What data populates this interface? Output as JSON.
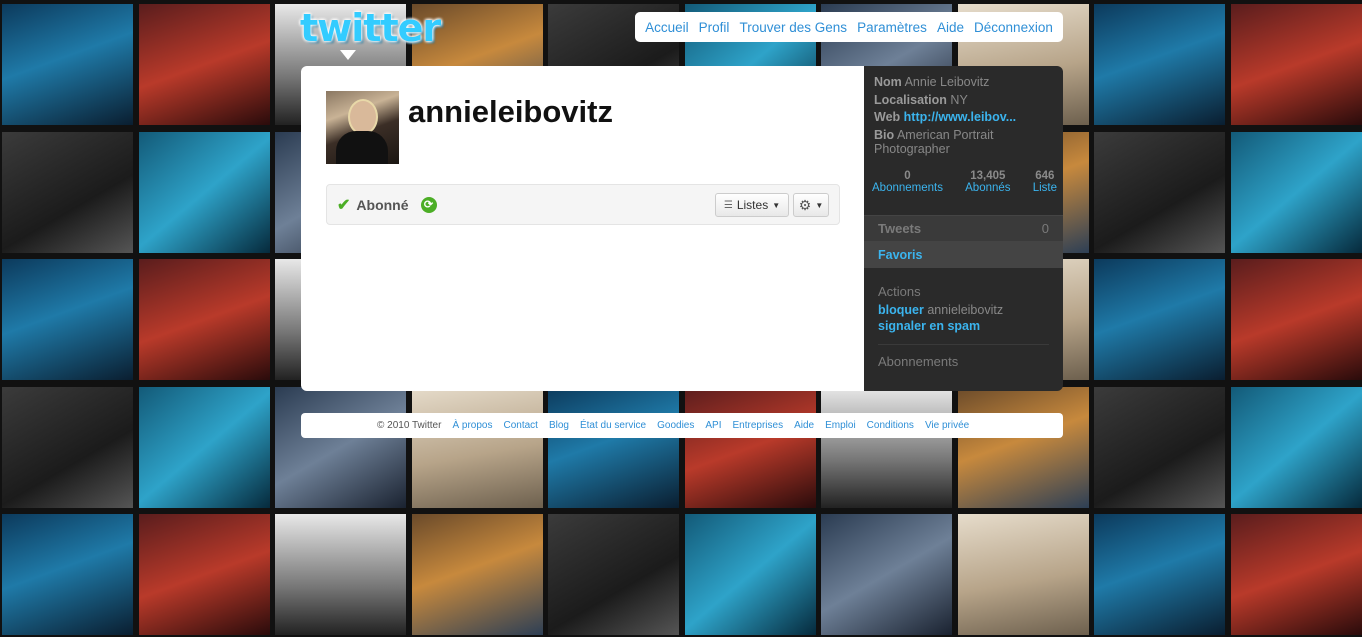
{
  "logo": {
    "text": "twitter"
  },
  "nav": {
    "items": [
      "Accueil",
      "Profil",
      "Trouver des Gens",
      "Paramètres",
      "Aide",
      "Déconnexion"
    ]
  },
  "profile": {
    "screen_name": "annieleibovitz"
  },
  "follow": {
    "state": "Abonné",
    "lists_label": "Listes",
    "check_icon": "checkmark-icon",
    "refresh_icon": "refresh-icon"
  },
  "sidebar": {
    "name_label": "Nom",
    "name_value": "Annie Leibovitz",
    "location_label": "Localisation",
    "location_value": "NY",
    "web_label": "Web",
    "web_value": "http://www.leibov...",
    "bio_label": "Bio",
    "bio_value": "American Portrait Photographer",
    "stats": [
      {
        "count": "0",
        "label": "Abonnements"
      },
      {
        "count": "13,405",
        "label": "Abonnés"
      },
      {
        "count": "646",
        "label": "Liste"
      }
    ],
    "tweets_label": "Tweets",
    "tweets_count": "0",
    "favorites_label": "Favoris",
    "actions_heading": "Actions",
    "block_link": "bloquer",
    "block_user": "annieleibovitz",
    "report_link": "signaler en spam",
    "following_heading": "Abonnements"
  },
  "footer": {
    "copyright": "© 2010 Twitter",
    "links": [
      "À propos",
      "Contact",
      "Blog",
      "État du service",
      "Goodies",
      "API",
      "Entreprises",
      "Aide",
      "Emploi",
      "Conditions",
      "Vie privée"
    ]
  },
  "colors": {
    "accent": "#2f8fd6",
    "sidebar_bg": "#2a2a2a",
    "sidebar_link": "#3bb4ee",
    "follow_green": "#4cae26",
    "logo_blue": "#33ccff"
  }
}
